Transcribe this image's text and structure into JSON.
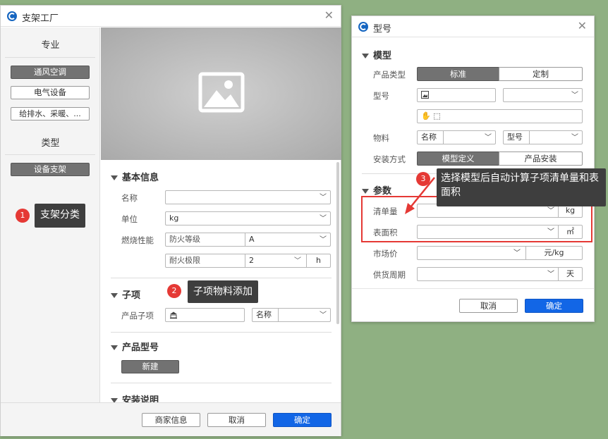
{
  "left_window": {
    "title": "支架工厂",
    "sidebar": {
      "heading_major": "专业",
      "major_items": [
        "通风空调",
        "电气设备",
        "给排水、采暖、..."
      ],
      "heading_type": "类型",
      "type_items": [
        "设备支架"
      ]
    },
    "basic_info": {
      "title": "基本信息",
      "name_label": "名称",
      "name_value": "",
      "unit_label": "单位",
      "unit_value": "kg",
      "fire_label": "燃烧性能",
      "fire_grade_placeholder": "防火等级",
      "fire_grade_value": "A",
      "fire_limit_placeholder": "耐火极限",
      "fire_limit_value": "2",
      "fire_limit_unit": "h"
    },
    "sub_items": {
      "title": "子项",
      "product_label": "产品子项",
      "name_label": "名称"
    },
    "product_model": {
      "title": "产品型号",
      "new_button": "新建"
    },
    "install": {
      "title": "安装说明"
    },
    "footer": {
      "vendor_button": "商家信息",
      "cancel_button": "取消",
      "ok_button": "确定"
    }
  },
  "right_window": {
    "title": "型号",
    "model_section": "模型",
    "product_type_label": "产品类型",
    "product_type_options": [
      "标准",
      "定制"
    ],
    "model_label": "型号",
    "material_label": "物料",
    "material_name": "名称",
    "material_model": "型号",
    "install_label": "安装方式",
    "install_options": [
      "模型定义",
      "产品安装"
    ],
    "params_section": "参数",
    "bom_label": "清单量",
    "bom_unit": "kg",
    "area_label": "表面积",
    "area_unit": "㎡",
    "price_label": "市场价",
    "price_unit": "元/kg",
    "period_label": "供货周期",
    "period_unit": "天",
    "cancel_button": "取消",
    "ok_button": "确定"
  },
  "annotations": [
    {
      "number": "1",
      "text": "支架分类"
    },
    {
      "number": "2",
      "text": "子项物料添加"
    },
    {
      "number": "3",
      "text": "选择模型后自动计算子项清单量和表面积"
    }
  ],
  "colors": {
    "background": "#8fb082",
    "accent_blue": "#1266e6",
    "highlight_red": "#e53935",
    "tooltip": "#3e3e3e"
  }
}
